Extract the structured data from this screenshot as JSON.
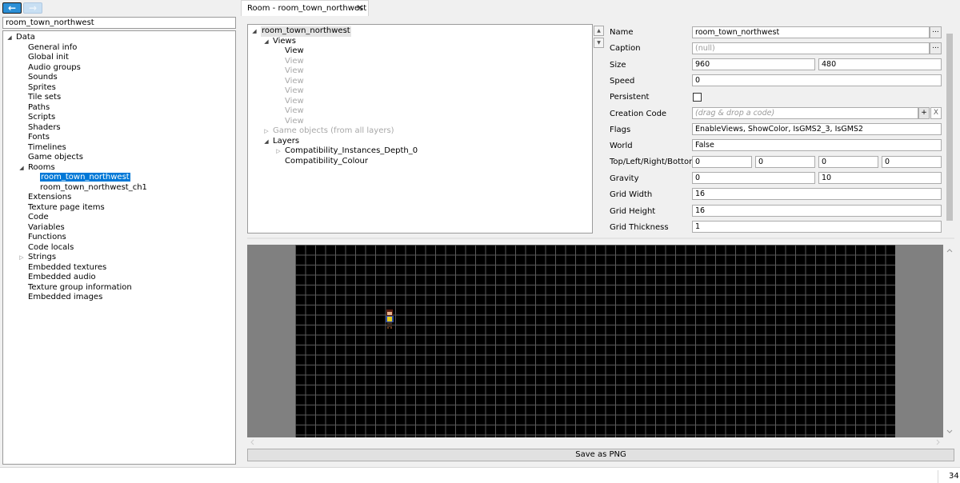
{
  "nav": {
    "back_icon": "arrow-left-icon",
    "forward_icon": "arrow-right-icon"
  },
  "search": {
    "value": "room_town_northwest"
  },
  "data_tree": {
    "root": "Data",
    "items": [
      "General info",
      "Global init",
      "Audio groups",
      "Sounds",
      "Sprites",
      "Tile sets",
      "Paths",
      "Scripts",
      "Shaders",
      "Fonts",
      "Timelines",
      "Game objects"
    ],
    "rooms_label": "Rooms",
    "rooms": [
      "room_town_northwest",
      "room_town_northwest_ch1"
    ],
    "after_rooms": [
      "Extensions",
      "Texture page items",
      "Code",
      "Variables",
      "Functions",
      "Code locals"
    ],
    "strings_label": "Strings",
    "after_strings": [
      "Embedded textures",
      "Embedded audio",
      "Texture group information",
      "Embedded images"
    ]
  },
  "tab": {
    "label": "Room - room_town_northwest",
    "close": "✕"
  },
  "room_tree": {
    "root": "room_town_northwest",
    "views_label": "Views",
    "views": [
      "View",
      "View",
      "View",
      "View",
      "View",
      "View",
      "View",
      "View"
    ],
    "game_objects": "Game objects (from all layers)",
    "layers_label": "Layers",
    "layers": [
      "Compatibility_Instances_Depth_0",
      "Compatibility_Colour"
    ]
  },
  "props": {
    "name_label": "Name",
    "name": "room_town_northwest",
    "caption_label": "Caption",
    "caption_placeholder": "(null)",
    "size_label": "Size",
    "width": "960",
    "height": "480",
    "speed_label": "Speed",
    "speed": "0",
    "persistent_label": "Persistent",
    "persistent": false,
    "creation_code_label": "Creation Code",
    "creation_code_placeholder": "(drag & drop a code)",
    "flags_label": "Flags",
    "flags": "EnableViews, ShowColor, IsGMS2_3, IsGMS2",
    "world_label": "World",
    "world": "False",
    "tlrb_label": "Top/Left/Right/Bottom",
    "top": "0",
    "left": "0",
    "right": "0",
    "bottom": "0",
    "gravity_label": "Gravity",
    "gravity_x": "0",
    "gravity_y": "10",
    "grid_width_label": "Grid Width",
    "grid_width": "16",
    "grid_height_label": "Grid Height",
    "grid_height": "16",
    "grid_thickness_label": "Grid Thickness",
    "grid_thickness": "1",
    "dots": "...",
    "plus": "+",
    "x": "X"
  },
  "preview": {
    "save_label": "Save as PNG"
  },
  "status": {
    "number": "34"
  }
}
